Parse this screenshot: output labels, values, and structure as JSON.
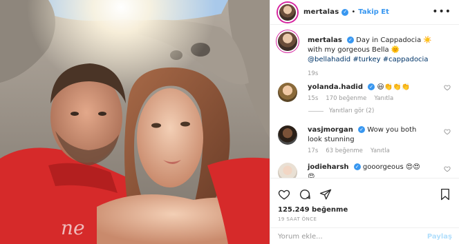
{
  "post": {
    "username": "mertalas",
    "follow_label": "Takip Et",
    "separator": "•",
    "more_glyph": "•••"
  },
  "caption": {
    "username": "mertalas",
    "line1": "Day in Cappadocia ☀️",
    "line2": "with my gorgeous Bella 🌞",
    "mention": "@bellahadid",
    "hashtags": [
      "#turkey",
      "#cappadocia"
    ],
    "time": "19s"
  },
  "comments": [
    {
      "username": "yolanda.hadid",
      "text": "😃👏👏👏",
      "time": "15s",
      "likes": "170 beğenme",
      "reply": "Yanıtla",
      "view_replies": "Yanıtları gör (2)"
    },
    {
      "username": "vasjmorgan",
      "text": "Wow you both",
      "text2": "look stunning",
      "time": "17s",
      "likes": "63 beğenme",
      "reply": "Yanıtla"
    },
    {
      "username": "jodieharsh",
      "text": "gooorgeous 😍😍",
      "text2": "😍"
    }
  ],
  "stats": {
    "likes": "125.249 beğenme",
    "posted": "19 SAAT ÖNCE"
  },
  "composer": {
    "placeholder": "Yorum ekle...",
    "share_label": "Paylaş"
  },
  "icons": {
    "more": "more-options-icon",
    "like": "heart-icon",
    "comment": "comment-icon",
    "share": "send-icon",
    "save": "bookmark-icon",
    "verified": "verified-badge-icon"
  },
  "colors": {
    "link": "#3897f0",
    "text": "#262626",
    "muted": "#999999",
    "verified": "#3897f0",
    "share_disabled": "#b2dffc"
  }
}
